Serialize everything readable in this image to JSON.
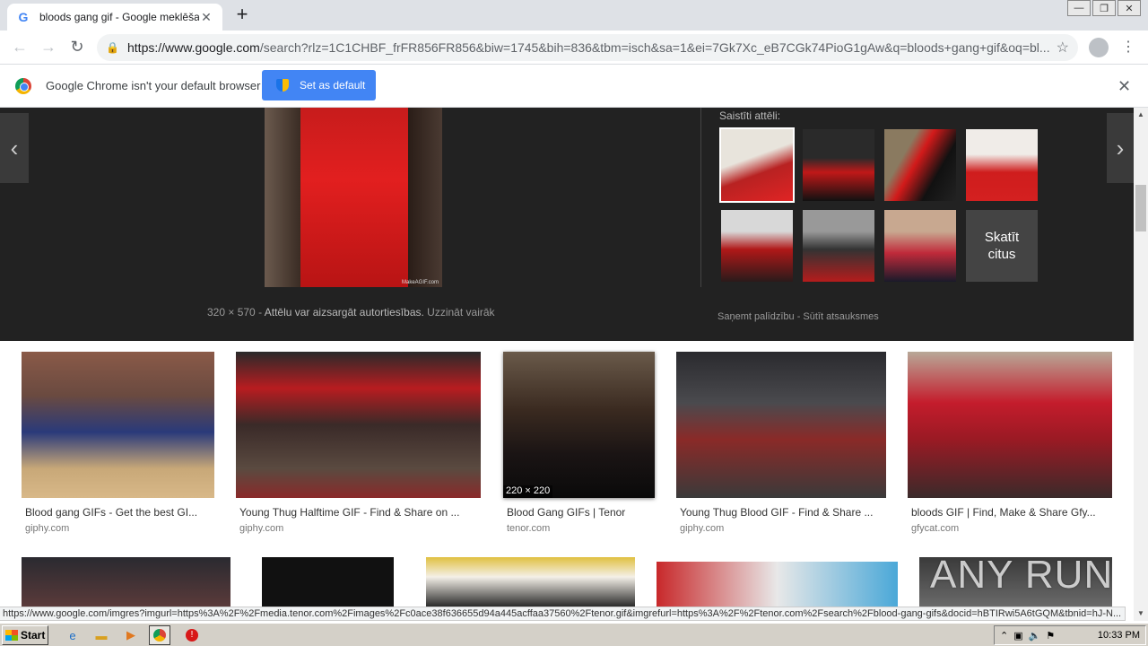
{
  "browser": {
    "tab_title": "bloods gang gif - Google meklēšana",
    "tab_close": "✕",
    "new_tab": "+",
    "window_controls": [
      "—",
      "❐",
      "✕"
    ],
    "nav": {
      "back": "←",
      "forward": "→",
      "reload": "↻"
    },
    "url_domain": "https://www.google.com",
    "url_rest": "/search?rlz=1C1CHBF_frFR856FR856&biw=1745&bih=836&tbm=isch&sa=1&ei=7Gk7Xc_eB7CGk74PioG1gAw&q=bloods+gang+gif&oq=bl...",
    "bookmark_icon": "☆",
    "menu_icon": "⋮"
  },
  "infobar": {
    "text": "Google Chrome isn't your default browser",
    "button": "Set as default",
    "close": "✕"
  },
  "panel": {
    "prev": "‹",
    "next": "›",
    "image_watermark": "MakeAGIF.com",
    "dimensions": "320 × 570",
    "separator": "-",
    "rights": "Attēlu var aizsargāt autortiesības.",
    "learn_more": "Uzzināt vairāk",
    "related_label": "Saistīti attēli:",
    "see_more": "Skatīt citus",
    "help": "Saņemt palīdzību",
    "feedback": "Sūtīt atsauksmes",
    "help_sep": "-"
  },
  "results": [
    {
      "caption": "Blood gang GIFs - Get the best GI...",
      "source": "giphy.com"
    },
    {
      "caption": "Young Thug Halftime GIF - Find & Share on ...",
      "source": "giphy.com"
    },
    {
      "caption": "Blood Gang GIFs | Tenor",
      "source": "tenor.com",
      "dims": "220 × 220"
    },
    {
      "caption": "Young Thug Blood GIF - Find & Share ...",
      "source": "giphy.com"
    },
    {
      "caption": "bloods GIF | Find, Make & Share Gfy...",
      "source": "gfycat.com"
    }
  ],
  "status_url": "https://www.google.com/imgres?imgurl=https%3A%2F%2Fmedia.tenor.com%2Fimages%2Fc0ace38f636655d94a445acffaa37560%2Ftenor.gif&imgrefurl=https%3A%2F%2Ftenor.com%2Fsearch%2Fblood-gang-gifs&docid=hBTIRwi5A6tGQM&tbnid=hJ-N...",
  "watermark": "ANY RUN",
  "taskbar": {
    "start": "Start",
    "clock": "10:33 PM"
  }
}
